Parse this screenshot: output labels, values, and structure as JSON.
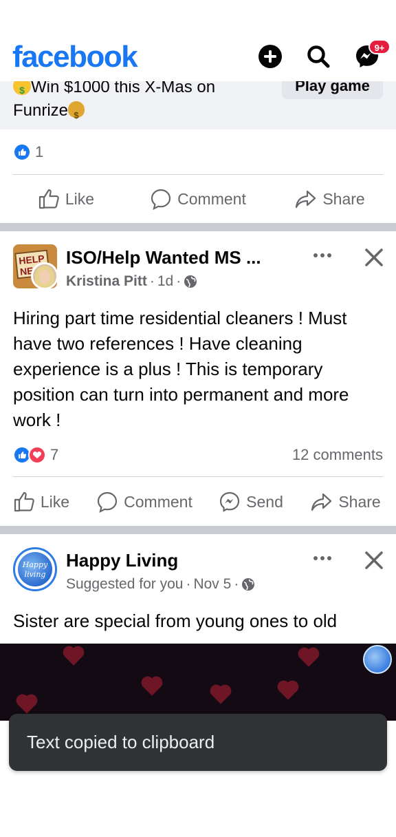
{
  "app": {
    "logo": "facebook",
    "notifications_badge": "9+",
    "brand_color": "#1877f2"
  },
  "ad": {
    "text_line1": "Win $1000 this X-Mas on",
    "text_line2": "Funrize",
    "play_button": "Play game",
    "reaction_count": "1",
    "actions": [
      "Like",
      "Comment",
      "Share"
    ]
  },
  "post1": {
    "group_name": "ISO/Help Wanted MS ...",
    "group_avatar_sign": "HELP NE",
    "author": "Kristina Pitt",
    "time": "1d",
    "body": "Hiring part time residential cleaners ! Must have two references ! Have cleaning experience is a plus ! This is temporary position can turn into permanent and more work !",
    "reaction_count": "7",
    "comments": "12 comments",
    "actions": [
      "Like",
      "Comment",
      "Send",
      "Share"
    ]
  },
  "post2": {
    "page_name": "Happy Living",
    "avatar_text": "Happy living",
    "subtitle": "Suggested for you",
    "time": "Nov 5",
    "body": "Sister are special from young ones to old"
  },
  "toast": {
    "message": "Text copied to clipboard"
  }
}
